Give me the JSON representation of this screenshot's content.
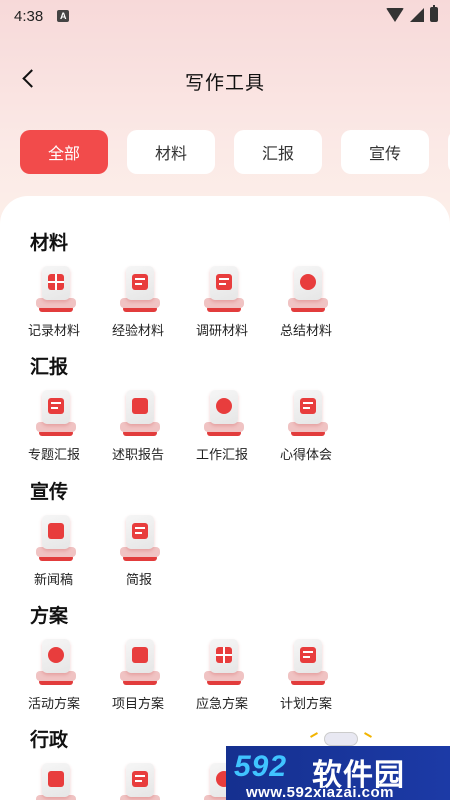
{
  "status_bar": {
    "time": "4:38",
    "notif_icon": "A"
  },
  "header": {
    "title": "写作工具"
  },
  "tabs": [
    {
      "label": "全部",
      "active": true
    },
    {
      "label": "材料",
      "active": false
    },
    {
      "label": "汇报",
      "active": false
    },
    {
      "label": "宣传",
      "active": false
    }
  ],
  "sections": [
    {
      "title": "材料",
      "tools": [
        "记录材料",
        "经验材料",
        "调研材料",
        "总结材料"
      ]
    },
    {
      "title": "汇报",
      "tools": [
        "专题汇报",
        "述职报告",
        "工作汇报",
        "心得体会"
      ]
    },
    {
      "title": "宣传",
      "tools": [
        "新闻稿",
        "简报"
      ]
    },
    {
      "title": "方案",
      "tools": [
        "活动方案",
        "项目方案",
        "应急方案",
        "计划方案"
      ]
    },
    {
      "title": "行政",
      "tools": [
        "",
        "",
        ""
      ]
    }
  ],
  "watermark": {
    "logo_num": "592",
    "logo_cn": "软件园",
    "url": "www.592xiazai.com"
  },
  "colors": {
    "accent": "#f24b4b",
    "panel": "#ffffff"
  }
}
